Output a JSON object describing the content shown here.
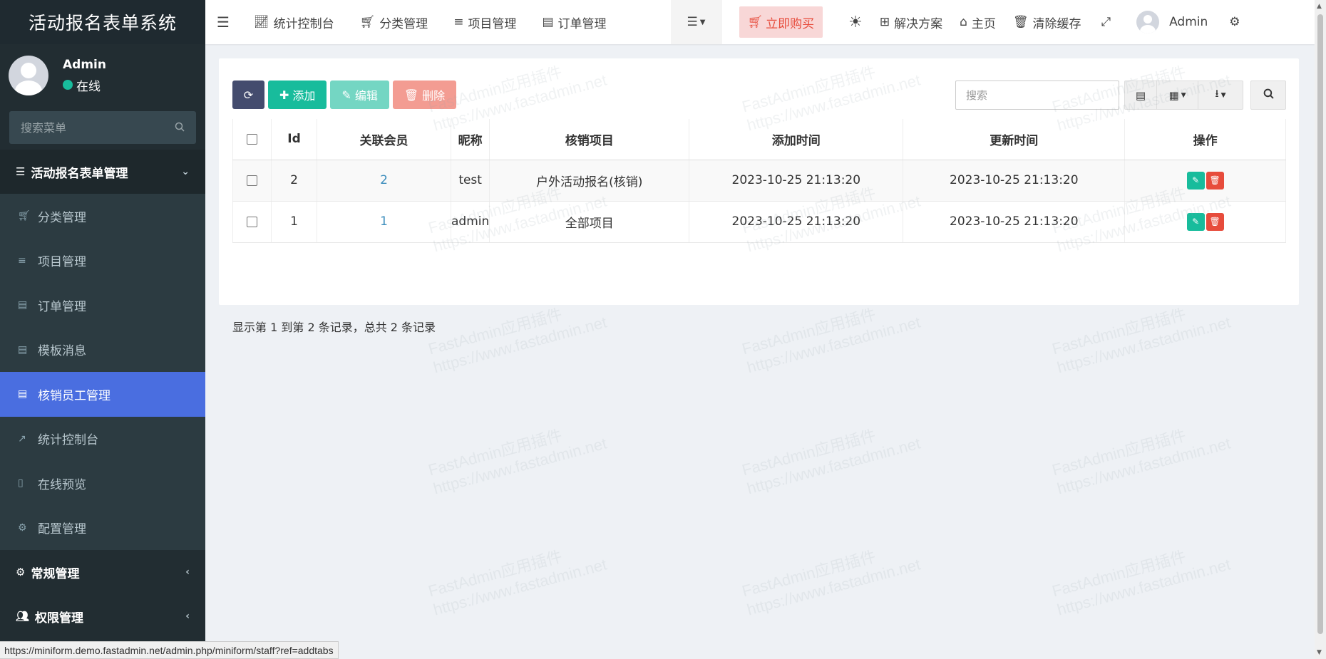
{
  "brand": {
    "title": "活动报名表单系统"
  },
  "user": {
    "name": "Admin",
    "status": "在线"
  },
  "sidebar": {
    "search_placeholder": "搜索菜单",
    "section": "活动报名表单管理",
    "items": [
      {
        "label": "分类管理",
        "icon": "cart-icon"
      },
      {
        "label": "项目管理",
        "icon": "list-icon"
      },
      {
        "label": "订单管理",
        "icon": "file-icon"
      },
      {
        "label": "模板消息",
        "icon": "file-icon"
      },
      {
        "label": "核销员工管理",
        "icon": "file-icon",
        "active": true
      },
      {
        "label": "统计控制台",
        "icon": "chart-icon"
      },
      {
        "label": "在线预览",
        "icon": "mobile-icon"
      },
      {
        "label": "配置管理",
        "icon": "cogs-icon"
      }
    ],
    "groups": [
      {
        "label": "常规管理",
        "icon": "cogs-icon"
      },
      {
        "label": "权限管理",
        "icon": "users-icon"
      }
    ]
  },
  "topnav": {
    "tabs": [
      {
        "label": "统计控制台",
        "icon": "chart-icon"
      },
      {
        "label": "分类管理",
        "icon": "cart-icon"
      },
      {
        "label": "项目管理",
        "icon": "list-icon"
      },
      {
        "label": "订单管理",
        "icon": "file-icon"
      }
    ],
    "buy": "立即购买",
    "solutions": "解决方案",
    "home": "主页",
    "clear_cache": "清除缓存",
    "admin": "Admin"
  },
  "toolbar": {
    "add": "添加",
    "edit": "编辑",
    "delete": "删除",
    "search_placeholder": "搜索"
  },
  "table": {
    "columns": [
      "Id",
      "关联会员",
      "昵称",
      "核销项目",
      "添加时间",
      "更新时间",
      "操作"
    ],
    "rows": [
      {
        "id": "2",
        "member": "2",
        "nickname": "test",
        "project": "户外活动报名(核销)",
        "created": "2023-10-25 21:13:20",
        "updated": "2023-10-25 21:13:20"
      },
      {
        "id": "1",
        "member": "1",
        "nickname": "admin",
        "project": "全部项目",
        "created": "2023-10-25 21:13:20",
        "updated": "2023-10-25 21:13:20"
      }
    ]
  },
  "pager": {
    "info": "显示第 1 到第 2 条记录，总共 2 条记录"
  },
  "statusbar": {
    "url": "https://miniform.demo.fastadmin.net/admin.php/miniform/staff?ref=addtabs"
  },
  "watermark": {
    "line1": "FastAdmin应用插件",
    "line2": "https://www.fastadmin.net"
  },
  "colors": {
    "accent": "#4a6ee0",
    "success": "#18bc9c",
    "danger": "#e74c3c",
    "sidebar": "#222d32"
  }
}
